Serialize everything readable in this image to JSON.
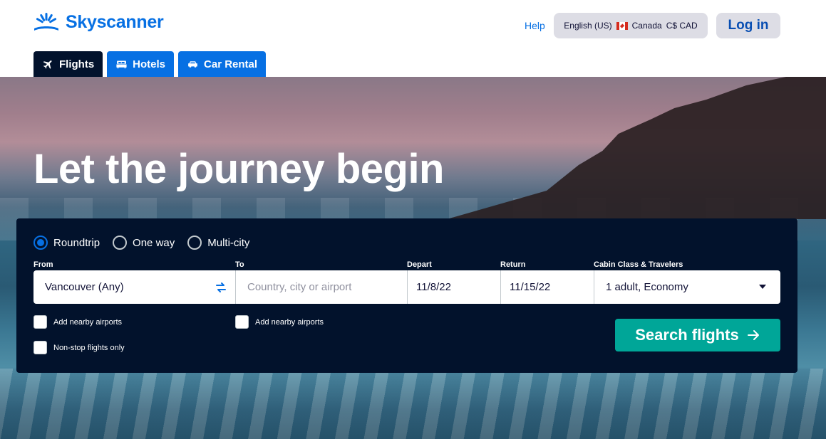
{
  "brand": {
    "name": "Skyscanner",
    "color": "#0770e3"
  },
  "header": {
    "help": "Help",
    "locale": {
      "language": "English (US)",
      "country": "Canada",
      "currency": "C$ CAD"
    },
    "login": "Log in"
  },
  "tabs": [
    {
      "label": "Flights",
      "icon": "plane-icon",
      "active": true
    },
    {
      "label": "Hotels",
      "icon": "bed-icon",
      "active": false
    },
    {
      "label": "Car Rental",
      "icon": "car-icon",
      "active": false
    }
  ],
  "hero": {
    "title": "Let the journey begin"
  },
  "search": {
    "trip_types": [
      {
        "label": "Roundtrip",
        "checked": true
      },
      {
        "label": "One way",
        "checked": false
      },
      {
        "label": "Multi-city",
        "checked": false
      }
    ],
    "labels": {
      "from": "From",
      "to": "To",
      "depart": "Depart",
      "return": "Return",
      "cabin": "Cabin Class & Travelers"
    },
    "from_value": "Vancouver (Any)",
    "to_placeholder": "Country, city or airport",
    "depart_value": "11/8/22",
    "return_value": "11/15/22",
    "cabin_value": "1 adult, Economy",
    "checkboxes": {
      "from_nearby": "Add nearby airports",
      "to_nearby": "Add nearby airports",
      "nonstop": "Non-stop flights only"
    },
    "submit": "Search flights"
  },
  "colors": {
    "panel": "#02122c",
    "cta": "#00a698",
    "accent": "#0770e3"
  }
}
